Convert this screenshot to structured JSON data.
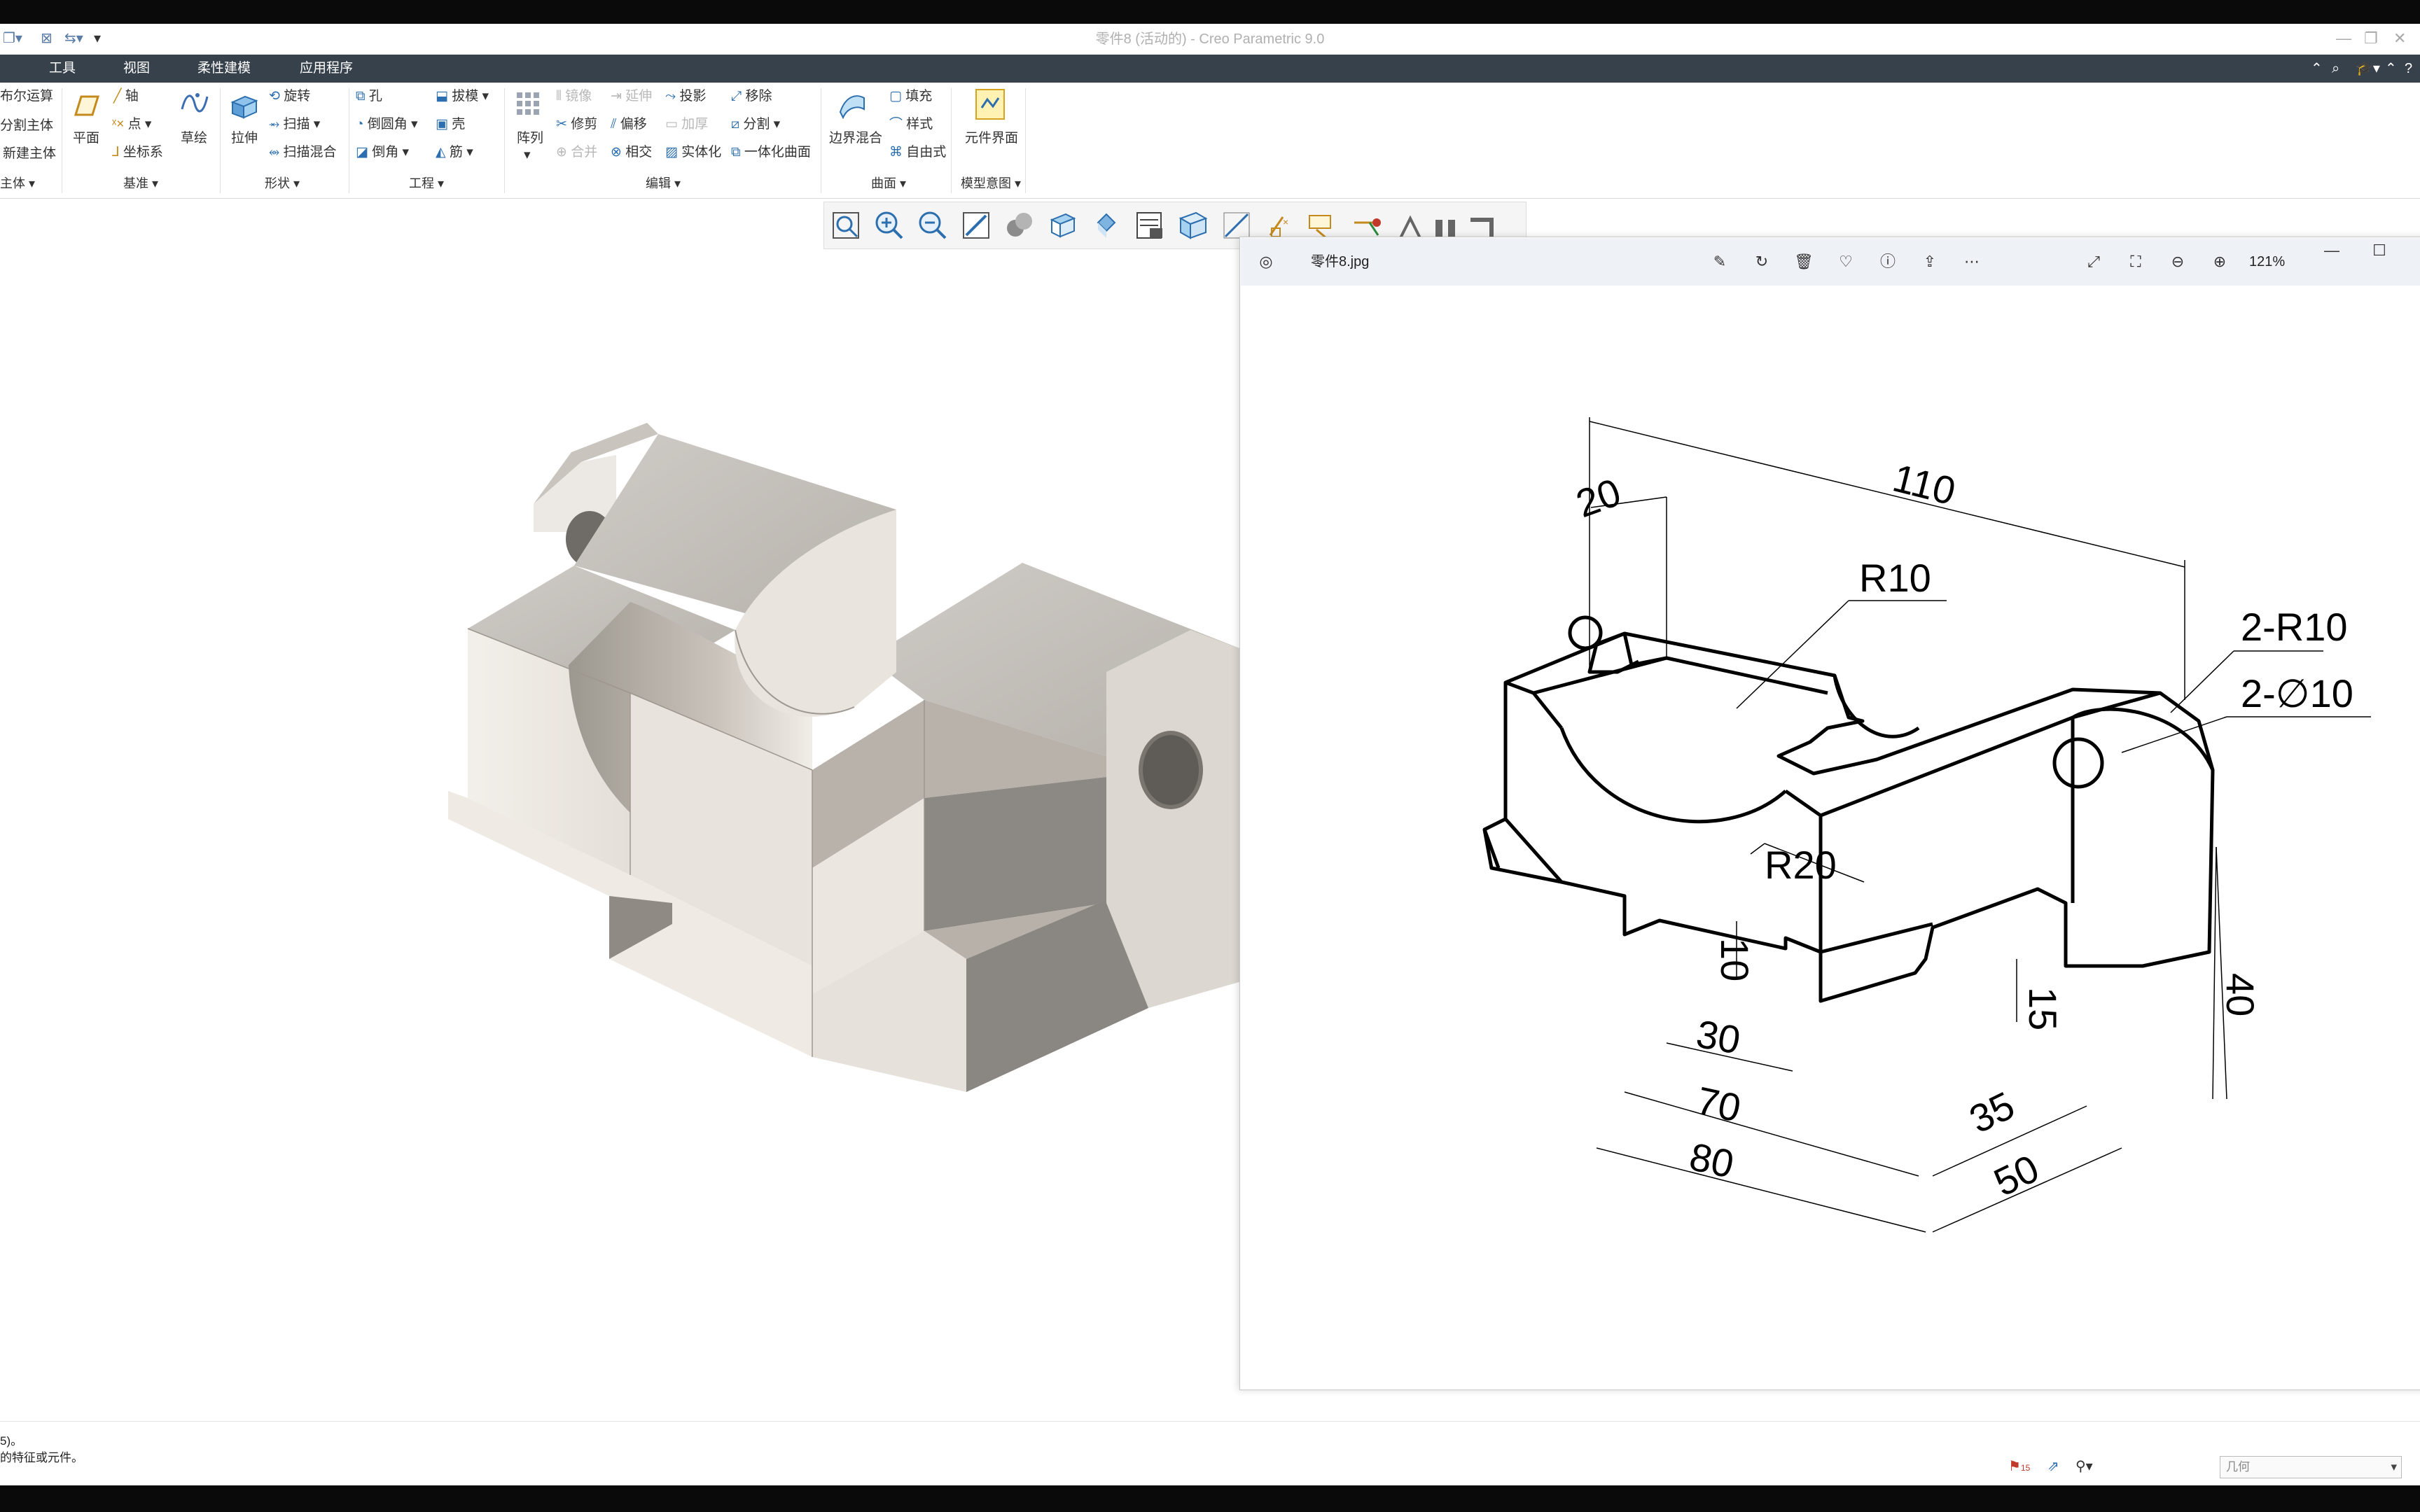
{
  "app": {
    "title": "零件8 (活动的) - Creo Parametric 9.0",
    "accent": "#36414c"
  },
  "quick_access": {
    "icons": [
      "window-icon",
      "close-window-icon",
      "regenerate-icon",
      "customize-icon"
    ]
  },
  "menu": {
    "items": [
      "工具",
      "视图",
      "柔性建模",
      "应用程序"
    ],
    "first_partial": "​"
  },
  "ribbon": {
    "body_group": {
      "items": [
        "布尔运算",
        "分割主体",
        "新建主体"
      ],
      "label": "主体"
    },
    "datum_group": {
      "plane": "平面",
      "axis": "轴",
      "point": "点",
      "csys": "坐标系",
      "sketch": "草绘",
      "label": "基准"
    },
    "shapes_group": {
      "extrude": "拉伸",
      "revolve": "旋转",
      "sweep": "扫描",
      "swept_blend": "扫描混合",
      "label": "形状"
    },
    "engineering_group": {
      "hole": "孔",
      "round": "倒圆角",
      "chamfer": "倒角",
      "draft": "拔模",
      "shell": "壳",
      "rib": "筋",
      "label": "工程"
    },
    "editing_group": {
      "pattern": "阵列",
      "mirror": "镜像",
      "trim": "修剪",
      "merge": "合并",
      "extend": "延伸",
      "offset": "偏移",
      "intersect": "相交",
      "project": "投影",
      "thicken": "加厚",
      "solidify": "实体化",
      "remove": "移除",
      "split": "分割",
      "unify": "一体化曲面",
      "label": "编辑"
    },
    "surfaces_group": {
      "boundary_blend": "边界混合",
      "fill": "填充",
      "style": "样式",
      "freestyle": "自由式",
      "label": "曲面"
    },
    "model_intent_group": {
      "component_interface": "元件界面",
      "label": "模型意图"
    }
  },
  "view_toolbar": {
    "icons": [
      "refit-icon",
      "zoom-in-icon",
      "zoom-out-icon",
      "repaint-icon",
      "display-style-icon",
      "saved-orientations-icon",
      "view-manager-icon",
      "annotation-display-icon",
      "perspective-icon",
      "section-icon",
      "datum-display-icon",
      "spin-center-icon",
      "sketch-display-icon"
    ]
  },
  "photo_viewer": {
    "filename": "零件8.jpg",
    "zoom": "121%"
  },
  "drawing": {
    "dims": [
      "110",
      "20",
      "R10",
      "2-R10",
      "2-∅10",
      "R20",
      "40",
      "10",
      "15",
      "30",
      "70",
      "35",
      "80",
      "50"
    ]
  },
  "status": {
    "line1": "5)。",
    "line2": "的特征或元件。",
    "flag_count": "15",
    "filter_value": "几何"
  }
}
